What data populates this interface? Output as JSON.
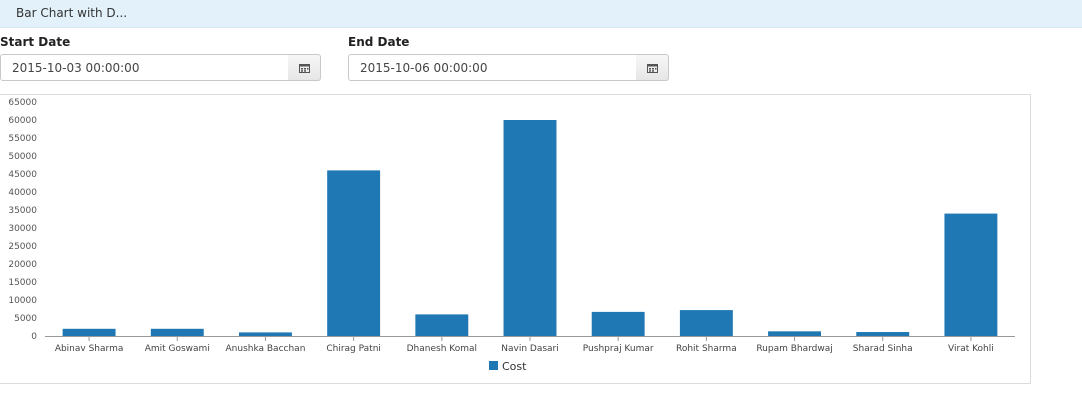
{
  "header": {
    "title": "Bar Chart with D..."
  },
  "filters": {
    "start_date": {
      "label": "Start Date",
      "value": "2015-10-03 00:00:00",
      "icon": "calendar-icon"
    },
    "end_date": {
      "label": "End Date",
      "value": "2015-10-06 00:00:00",
      "icon": "calendar-icon"
    }
  },
  "colors": {
    "bar": "#1f77b4",
    "title_bar": "#e2f1fa"
  },
  "chart_data": {
    "type": "bar",
    "categories": [
      "Abinav Sharma",
      "Amit Goswami",
      "Anushka Bacchan",
      "Chirag Patni",
      "Dhanesh Komal",
      "Navin Dasari",
      "Pushpraj Kumar",
      "Rohit Sharma",
      "Rupam Bhardwaj",
      "Sharad Sinha",
      "Virat Kohli"
    ],
    "series": [
      {
        "name": "Cost",
        "values": [
          2000,
          2000,
          1000,
          46000,
          6000,
          60000,
          6700,
          7200,
          1300,
          1100,
          34000
        ]
      }
    ],
    "ylim": [
      0,
      65000
    ],
    "yticks": [
      "0",
      "5000",
      "10000",
      "15000",
      "20000",
      "25000",
      "30000",
      "35000",
      "40000",
      "45000",
      "50000",
      "55000",
      "60000",
      "65000"
    ],
    "grid": false,
    "legend": "bottom-center"
  }
}
